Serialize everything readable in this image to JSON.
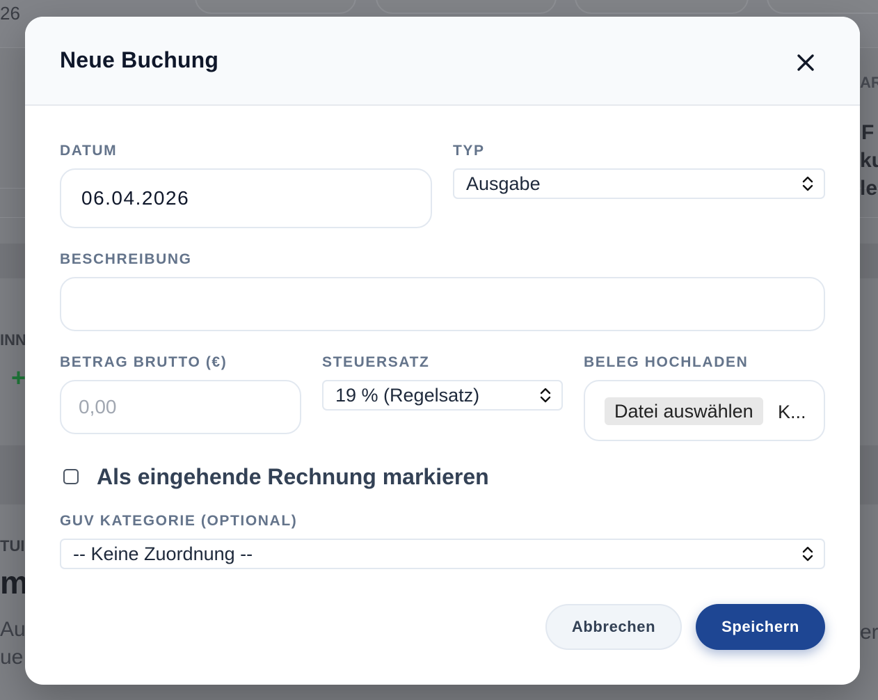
{
  "background": {
    "date_fragment": "26",
    "right_fragment_1": "ARG",
    "right_fragment_2": "F",
    "right_fragment_3": "ku",
    "right_fragment_4": "le",
    "left_fragment_1": "INN",
    "left_fragment_2": "+",
    "left_fragment_3": "TUI",
    "left_fragment_4": "m",
    "left_fragment_5": "Au",
    "left_fragment_6": "ue",
    "right_fragment_5": "er"
  },
  "modal": {
    "title": "Neue Buchung",
    "close_icon": "close-icon",
    "fields": {
      "datum": {
        "label": "DATUM",
        "value": "06.04.2026"
      },
      "typ": {
        "label": "TYP",
        "selected": "Ausgabe"
      },
      "beschreibung": {
        "label": "BESCHREIBUNG",
        "value": ""
      },
      "betrag": {
        "label": "BETRAG BRUTTO (€)",
        "placeholder": "0,00"
      },
      "steuersatz": {
        "label": "STEUERSATZ",
        "selected": "19 % (Regelsatz)"
      },
      "beleg": {
        "label": "BELEG HOCHLADEN",
        "button": "Datei auswählen",
        "status": "K..."
      },
      "eingehende_rechnung": {
        "label": "Als eingehende Rechnung markieren",
        "checked": false
      },
      "guv_kategorie": {
        "label": "GUV KATEGORIE (OPTIONAL)",
        "selected": "-- Keine Zuordnung --"
      }
    },
    "buttons": {
      "cancel": "Abbrechen",
      "save": "Speichern"
    }
  },
  "colors": {
    "primary": "#1e4693",
    "overlay": "#7e8085",
    "label": "#64748b",
    "title": "#0f172a"
  }
}
